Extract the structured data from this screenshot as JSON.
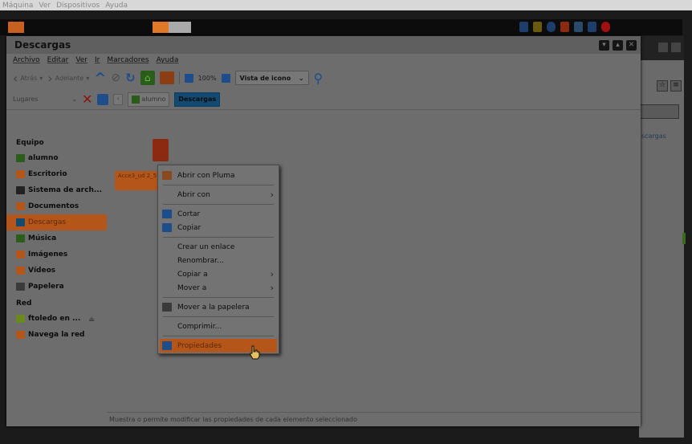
{
  "vbox_menu": [
    "Máquina",
    "Ver",
    "Dispositivos",
    "Ayuda"
  ],
  "window": {
    "title": "Descargas",
    "menus": [
      "Archivo",
      "Editar",
      "Ver",
      "Ir",
      "Marcadores",
      "Ayuda"
    ]
  },
  "toolbar": {
    "back_label": "Atrás",
    "forward_label": "Adelante",
    "zoom": "100%",
    "view_mode": "Vista de icono"
  },
  "location": {
    "places_label": "Lugares",
    "crumbs": [
      "alumno",
      "Descargas"
    ]
  },
  "sidebar": {
    "sections": [
      {
        "heading": "Equipo",
        "items": [
          {
            "label": "alumno",
            "color": "#2a5d1a"
          },
          {
            "label": "Escritorio",
            "color": "#b4551a"
          },
          {
            "label": "Sistema de arch...",
            "color": "#222222"
          },
          {
            "label": "Documentos",
            "color": "#b4551a"
          },
          {
            "label": "Descargas",
            "color": "#124a72",
            "selected": true
          },
          {
            "label": "Música",
            "color": "#2a5d1a"
          },
          {
            "label": "Imágenes",
            "color": "#b4551a"
          },
          {
            "label": "Vídeos",
            "color": "#b4551a"
          },
          {
            "label": "Papelera",
            "color": "#3a3a3a"
          }
        ]
      },
      {
        "heading": "Red",
        "items": [
          {
            "label": "ftoledo en ...",
            "color": "#6a8a20",
            "eject": "⏏"
          },
          {
            "label": "Navega la red",
            "color": "#b4551a"
          }
        ]
      }
    ]
  },
  "file": {
    "label": "Acce3_ud 2_5"
  },
  "context_menu": {
    "open_with_pluma": "Abrir con Pluma",
    "open_with": "Abrir con",
    "cut": "Cortar",
    "copy": "Copiar",
    "create_link": "Crear un enlace",
    "rename": "Renombrar...",
    "copy_to": "Copiar a",
    "move_to": "Mover a",
    "move_to_trash": "Mover a la papelera",
    "compress": "Comprimir...",
    "properties": "Propiedades"
  },
  "status_text": "Muestra o permite modificar las propiedades de cada elemento seleccionado",
  "bg_window": {
    "tab_text": "scargas"
  }
}
